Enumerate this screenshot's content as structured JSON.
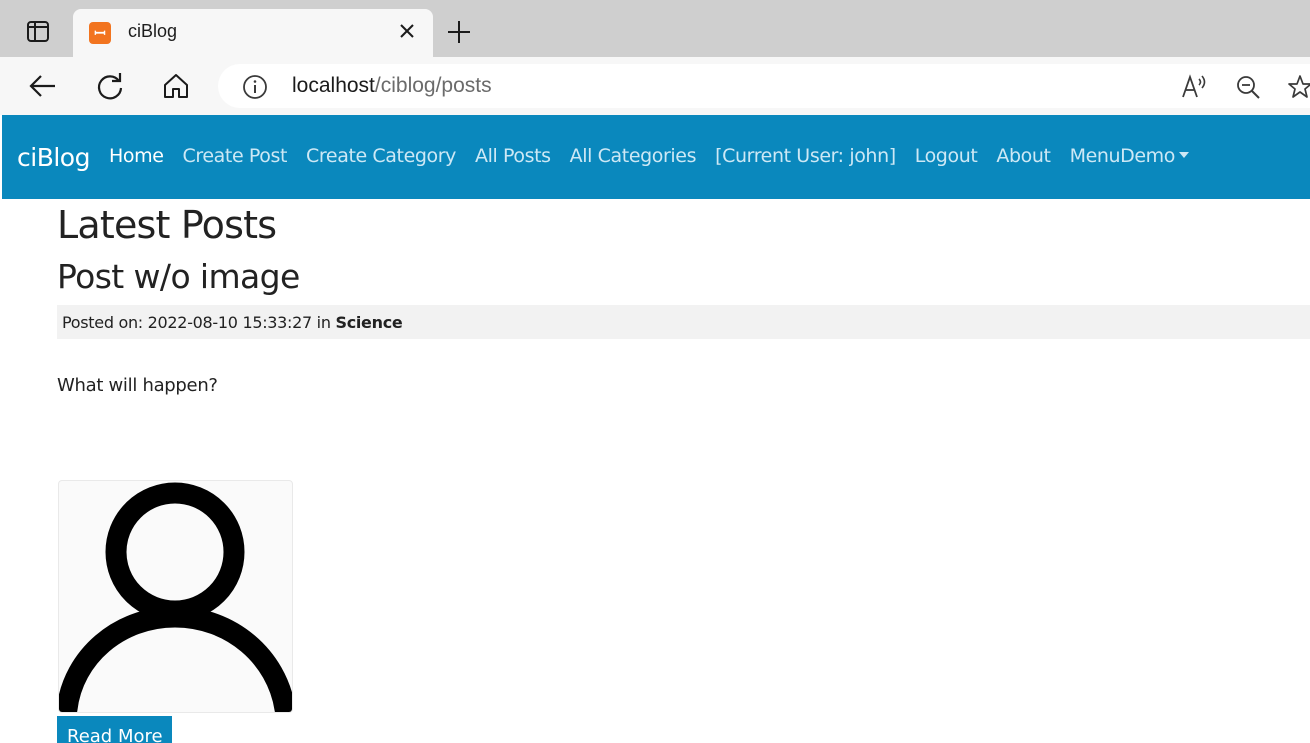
{
  "browser": {
    "tab": {
      "title": "ciBlog",
      "favicon": "xampp-icon"
    },
    "address": {
      "host": "localhost",
      "path": "/ciblog/posts"
    },
    "icons": [
      "sidebar-icon",
      "close-icon",
      "new-tab-icon",
      "back-icon",
      "refresh-icon",
      "home-icon",
      "info-icon",
      "read-aloud-icon",
      "zoom-out-icon",
      "favorites-icon"
    ]
  },
  "navbar": {
    "brand": "ciBlog",
    "items": [
      {
        "label": "Home",
        "active": true
      },
      {
        "label": "Create Post"
      },
      {
        "label": "Create Category"
      },
      {
        "label": "All Posts"
      },
      {
        "label": "All Categories"
      },
      {
        "label": "[Current User: john]"
      },
      {
        "label": "Logout"
      },
      {
        "label": "About"
      },
      {
        "label": "MenuDemo",
        "dropdown": true
      }
    ],
    "color": "#0a88bd"
  },
  "page": {
    "heading": "Latest Posts",
    "posts": [
      {
        "title": "Post w/o image",
        "meta_prefix": "Posted on: 2022-08-10 15:33:27 in ",
        "category": "Science",
        "body": "What will happen?",
        "thumbnail": "user-avatar-icon",
        "read_more": "Read More"
      }
    ]
  }
}
